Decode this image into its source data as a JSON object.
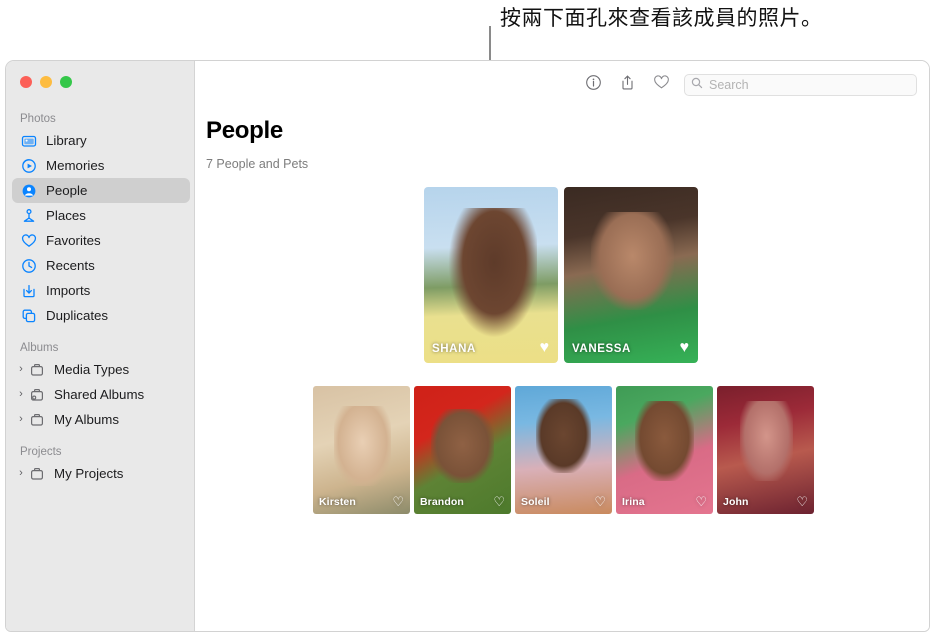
{
  "callout": {
    "text": "按兩下面孔來查看該成員的照片。"
  },
  "window": {
    "traffic_lights": {
      "close": "close-button",
      "minimize": "minimize-button",
      "zoom": "zoom-button"
    }
  },
  "sidebar": {
    "sections": [
      {
        "header": "Photos",
        "items": [
          {
            "label": "Library",
            "icon": "library-icon",
            "selected": false,
            "expandable": false
          },
          {
            "label": "Memories",
            "icon": "memories-icon",
            "selected": false,
            "expandable": false
          },
          {
            "label": "People",
            "icon": "people-icon",
            "selected": true,
            "expandable": false
          },
          {
            "label": "Places",
            "icon": "places-icon",
            "selected": false,
            "expandable": false
          },
          {
            "label": "Favorites",
            "icon": "heart-icon",
            "selected": false,
            "expandable": false
          },
          {
            "label": "Recents",
            "icon": "clock-icon",
            "selected": false,
            "expandable": false
          },
          {
            "label": "Imports",
            "icon": "import-icon",
            "selected": false,
            "expandable": false
          },
          {
            "label": "Duplicates",
            "icon": "duplicates-icon",
            "selected": false,
            "expandable": false
          }
        ]
      },
      {
        "header": "Albums",
        "items": [
          {
            "label": "Media Types",
            "icon": "folder-icon",
            "selected": false,
            "expandable": true,
            "chevron": "›"
          },
          {
            "label": "Shared Albums",
            "icon": "shared-folder-icon",
            "selected": false,
            "expandable": true,
            "chevron": "›"
          },
          {
            "label": "My Albums",
            "icon": "folder-icon",
            "selected": false,
            "expandable": true,
            "chevron": "›"
          }
        ]
      },
      {
        "header": "Projects",
        "items": [
          {
            "label": "My Projects",
            "icon": "folder-icon",
            "selected": false,
            "expandable": true,
            "chevron": "›"
          }
        ]
      }
    ]
  },
  "toolbar": {
    "buttons": [
      {
        "name": "info-icon",
        "title": "Info"
      },
      {
        "name": "share-icon",
        "title": "Share"
      },
      {
        "name": "heart-icon",
        "title": "Favorite"
      }
    ],
    "search": {
      "placeholder": "Search",
      "value": "",
      "icon": "search-icon"
    }
  },
  "main": {
    "title": "People",
    "subtitle": "7 People and Pets",
    "featured": [
      {
        "name": "SHANA",
        "favorite": true,
        "heart": "♥",
        "photo": "ph-shana"
      },
      {
        "name": "VANESSA",
        "favorite": true,
        "heart": "♥",
        "photo": "ph-vanessa"
      }
    ],
    "others": [
      {
        "name": "Kirsten",
        "favorite": false,
        "heart": "♡",
        "photo": "ph-kirsten"
      },
      {
        "name": "Brandon",
        "favorite": false,
        "heart": "♡",
        "photo": "ph-brandon"
      },
      {
        "name": "Soleil",
        "favorite": false,
        "heart": "♡",
        "photo": "ph-soleil"
      },
      {
        "name": "Irina",
        "favorite": false,
        "heart": "♡",
        "photo": "ph-irina"
      },
      {
        "name": "John",
        "favorite": false,
        "heart": "♡",
        "photo": "ph-john"
      }
    ]
  },
  "colors": {
    "accent": "#007aff",
    "sidebar_bg": "#e9e9e9",
    "selected_bg": "#cfcfcf",
    "traffic_red": "#fc6058",
    "traffic_yellow": "#fdbc40",
    "traffic_green": "#34c749"
  }
}
